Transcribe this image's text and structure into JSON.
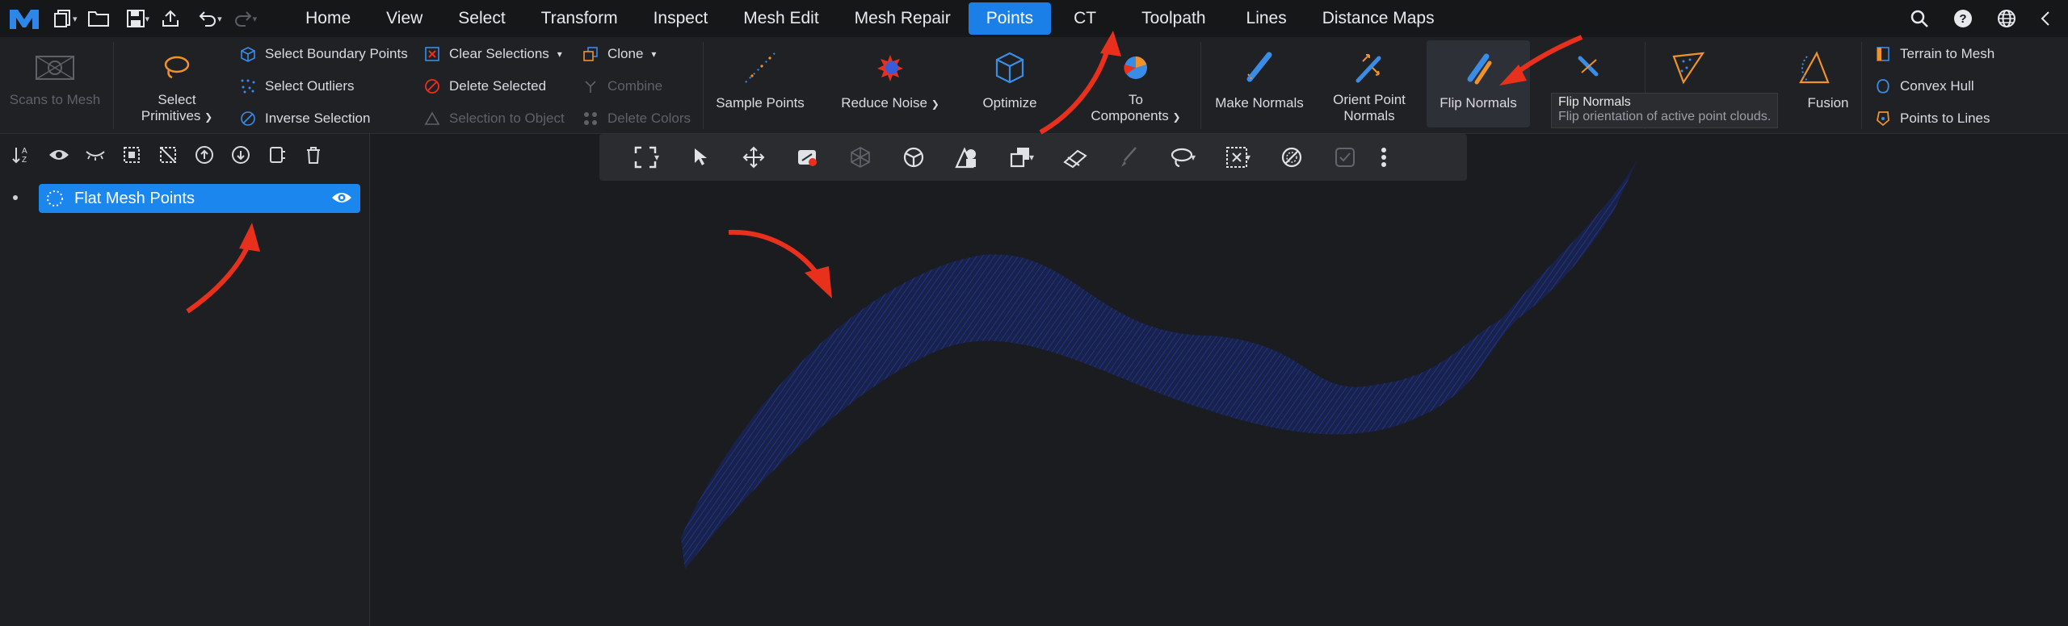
{
  "menu": {
    "tabs": [
      {
        "label": "Home"
      },
      {
        "label": "View"
      },
      {
        "label": "Select"
      },
      {
        "label": "Transform"
      },
      {
        "label": "Inspect"
      },
      {
        "label": "Mesh Edit"
      },
      {
        "label": "Mesh Repair"
      },
      {
        "label": "Points"
      },
      {
        "label": "CT"
      },
      {
        "label": "Toolpath"
      },
      {
        "label": "Lines"
      },
      {
        "label": "Distance Maps"
      }
    ],
    "active_tab": "Points"
  },
  "ribbon": {
    "scans_to_mesh": "Scans to Mesh",
    "select_primitives_line1": "Select",
    "select_primitives_line2": "Primitives",
    "select_boundary_points": "Select Boundary Points",
    "select_outliers": "Select Outliers",
    "inverse_selection": "Inverse Selection",
    "clear_selections": "Clear Selections",
    "delete_selected": "Delete Selected",
    "selection_to_object": "Selection to Object",
    "clone": "Clone",
    "combine": "Combine",
    "delete_colors": "Delete Colors",
    "sample_points": "Sample Points",
    "reduce_noise": "Reduce Noise",
    "optimize": "Optimize",
    "to_components_line1": "To",
    "to_components_line2": "Components",
    "make_normals": "Make Normals",
    "orient_point_normals_line1": "Orient Point",
    "orient_point_normals_line2": "Normals",
    "flip_normals": "Flip Normals",
    "fusion": "Fusion",
    "terrain_to_mesh": "Terrain to Mesh",
    "convex_hull": "Convex Hull",
    "points_to_lines": "Points to Lines"
  },
  "tooltip": {
    "title": "Flip Normals",
    "description": "Flip orientation of active point clouds."
  },
  "scene_tree": {
    "items": [
      {
        "label": "Flat Mesh Points",
        "selected": true,
        "visible": true
      }
    ]
  },
  "colors": {
    "accent": "#1a86ee",
    "annotation": "#e8301c",
    "point_cloud": "#1f2f86"
  }
}
